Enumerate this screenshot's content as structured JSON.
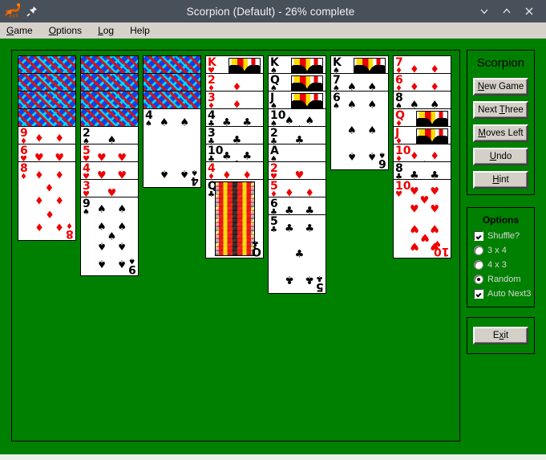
{
  "window": {
    "title": "Scorpion (Default) - 26% complete",
    "icon": "scorpion-icon",
    "pin_icon": "pin-icon",
    "minimize_label": "⌄",
    "maximize_label": "⌃",
    "close_label": "✕"
  },
  "menubar": {
    "items": [
      {
        "label": "Game",
        "accel": "G"
      },
      {
        "label": "Options",
        "accel": "O"
      },
      {
        "label": "Log",
        "accel": "L"
      },
      {
        "label": "Help",
        "accel": ""
      }
    ]
  },
  "controls": {
    "title": "Scorpion",
    "buttons": [
      {
        "label": "New Game",
        "accel": "N"
      },
      {
        "label": "Next Three",
        "accel": "T"
      },
      {
        "label": "Moves Left",
        "accel": "M"
      },
      {
        "label": "Undo",
        "accel": "U"
      },
      {
        "label": "Hint",
        "accel": "H"
      }
    ]
  },
  "options": {
    "title": "Options",
    "items": [
      {
        "type": "checkbox",
        "label": "Shuffle?",
        "checked": true
      },
      {
        "type": "radio",
        "label": "3 x 4",
        "checked": false
      },
      {
        "type": "radio",
        "label": "4 x 3",
        "checked": false
      },
      {
        "type": "radio",
        "label": "Random",
        "checked": true
      },
      {
        "type": "checkbox",
        "label": "Auto Next3",
        "checked": true
      }
    ]
  },
  "exit": {
    "label": "Exit",
    "accel": "x"
  },
  "colors": {
    "felt": "#008000",
    "titlebar": "#485059",
    "chrome": "#d6d2cb",
    "button_face": "#d4d0c8",
    "red_suit": "#ee0000",
    "black_suit": "#000000"
  },
  "tableau": {
    "columns": [
      {
        "facedown": 4,
        "cards": [
          {
            "rank": "9",
            "suit": "♦",
            "color": "red"
          },
          {
            "rank": "6",
            "suit": "♥",
            "color": "red"
          },
          {
            "rank": "8",
            "suit": "♦",
            "color": "red"
          }
        ]
      },
      {
        "facedown": 4,
        "cards": [
          {
            "rank": "2",
            "suit": "♠",
            "color": "black"
          },
          {
            "rank": "5",
            "suit": "♥",
            "color": "red"
          },
          {
            "rank": "4",
            "suit": "♥",
            "color": "red"
          },
          {
            "rank": "3",
            "suit": "♥",
            "color": "red"
          },
          {
            "rank": "9",
            "suit": "♠",
            "color": "black"
          }
        ]
      },
      {
        "facedown": 3,
        "cards": [
          {
            "rank": "4",
            "suit": "♠",
            "color": "black"
          }
        ]
      },
      {
        "facedown": 0,
        "cards": [
          {
            "rank": "K",
            "suit": "♥",
            "color": "red",
            "court": true
          },
          {
            "rank": "2",
            "suit": "♦",
            "color": "red"
          },
          {
            "rank": "3",
            "suit": "♦",
            "color": "red"
          },
          {
            "rank": "4",
            "suit": "♣",
            "color": "black"
          },
          {
            "rank": "3",
            "suit": "♣",
            "color": "black"
          },
          {
            "rank": "10",
            "suit": "♣",
            "color": "black"
          },
          {
            "rank": "4",
            "suit": "♦",
            "color": "red"
          },
          {
            "rank": "Q",
            "suit": "♣",
            "color": "black",
            "court": true
          }
        ]
      },
      {
        "facedown": 0,
        "cards": [
          {
            "rank": "K",
            "suit": "♠",
            "color": "black",
            "court": true
          },
          {
            "rank": "Q",
            "suit": "♠",
            "color": "black",
            "court": true
          },
          {
            "rank": "J",
            "suit": "♠",
            "color": "black",
            "court": true
          },
          {
            "rank": "10",
            "suit": "♠",
            "color": "black"
          },
          {
            "rank": "2",
            "suit": "♣",
            "color": "black"
          },
          {
            "rank": "A",
            "suit": "♠",
            "color": "black"
          },
          {
            "rank": "2",
            "suit": "♥",
            "color": "red"
          },
          {
            "rank": "5",
            "suit": "♦",
            "color": "red"
          },
          {
            "rank": "6",
            "suit": "♣",
            "color": "black"
          },
          {
            "rank": "5",
            "suit": "♣",
            "color": "black"
          }
        ]
      },
      {
        "facedown": 0,
        "cards": [
          {
            "rank": "K",
            "suit": "♠",
            "color": "black",
            "court": true
          },
          {
            "rank": "7",
            "suit": "♠",
            "color": "black"
          },
          {
            "rank": "6",
            "suit": "♠",
            "color": "black"
          }
        ]
      },
      {
        "facedown": 0,
        "cards": [
          {
            "rank": "7",
            "suit": "♦",
            "color": "red"
          },
          {
            "rank": "6",
            "suit": "♦",
            "color": "red"
          },
          {
            "rank": "8",
            "suit": "♠",
            "color": "black"
          },
          {
            "rank": "Q",
            "suit": "♦",
            "color": "red",
            "court": true
          },
          {
            "rank": "J",
            "suit": "♦",
            "color": "red",
            "court": true
          },
          {
            "rank": "10",
            "suit": "♦",
            "color": "red"
          },
          {
            "rank": "8",
            "suit": "♣",
            "color": "black"
          },
          {
            "rank": "10",
            "suit": "♥",
            "color": "red"
          }
        ]
      }
    ]
  }
}
